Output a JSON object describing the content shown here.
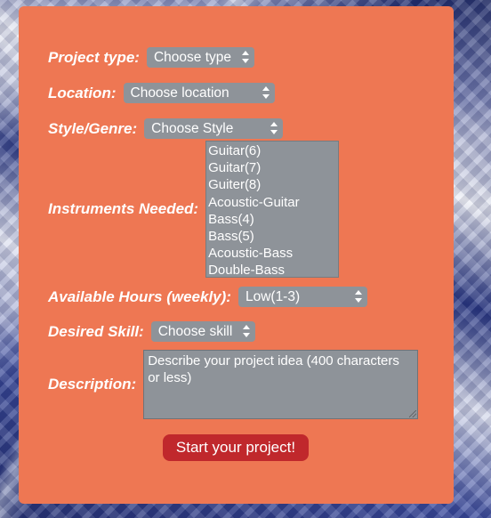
{
  "form": {
    "project_type": {
      "label": "Project type:",
      "selected": "Choose type"
    },
    "location": {
      "label": "Location:",
      "selected": "Choose location"
    },
    "style": {
      "label": "Style/Genre:",
      "selected": "Choose Style"
    },
    "instruments": {
      "label": "Instruments Needed:",
      "options": [
        "Guitar(6)",
        "Guitar(7)",
        "Guiter(8)",
        "Acoustic-Guitar",
        "Bass(4)",
        "Bass(5)",
        "Acoustic-Bass",
        "Double-Bass"
      ]
    },
    "hours": {
      "label": "Available Hours (weekly):",
      "selected": "Low(1-3)"
    },
    "skill": {
      "label": "Desired Skill:",
      "selected": "Choose skill"
    },
    "description": {
      "label": "Description:",
      "placeholder": "Describe your project idea (400 characters or less)"
    },
    "submit_label": "Start your project!"
  },
  "colors": {
    "panel": "#ee7753",
    "control": "#8e9399",
    "submit": "#c0282c",
    "text": "#ffffff"
  },
  "icons": {
    "select_arrows": "up-down-chevron-icon",
    "resize": "resize-grip-icon"
  }
}
